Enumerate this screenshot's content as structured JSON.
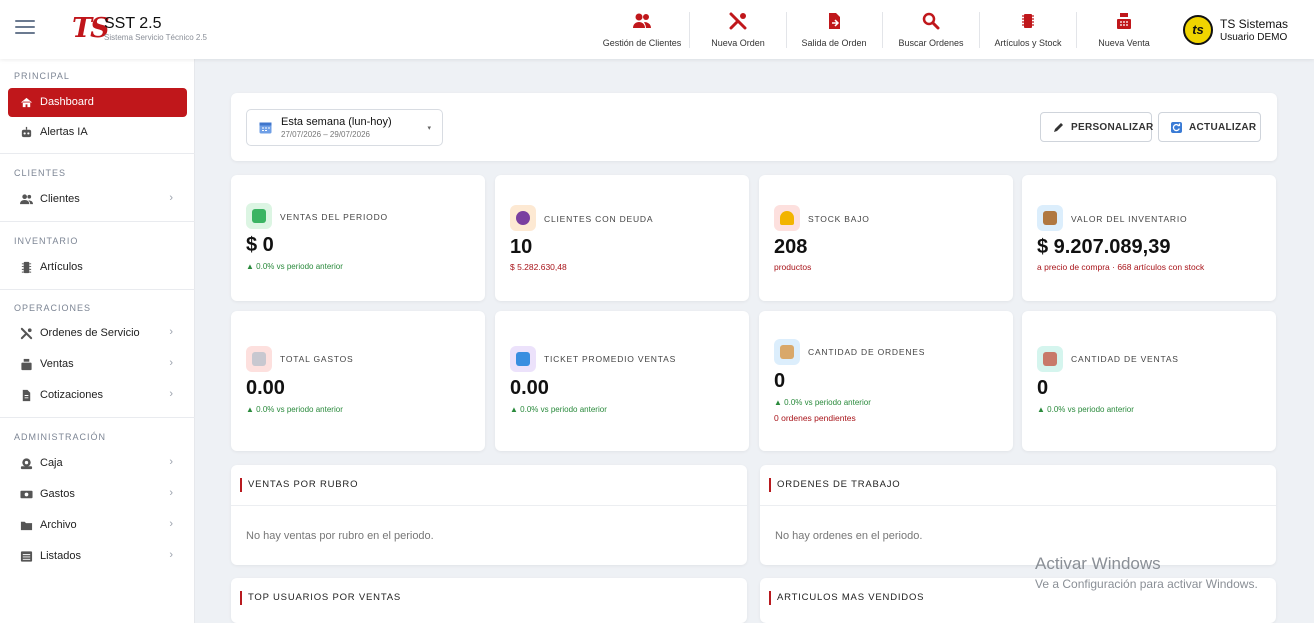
{
  "app": {
    "logo": "TS",
    "title": "SST 2.5",
    "subtitle": "Sistema Servicio Técnico 2.5"
  },
  "topnav": [
    {
      "label": "Gestión de Clientes",
      "icon": "users-icon"
    },
    {
      "label": "Nueva Orden",
      "icon": "tools-icon"
    },
    {
      "label": "Salida de Orden",
      "icon": "file-out-icon"
    },
    {
      "label": "Buscar Ordenes",
      "icon": "search-icon"
    },
    {
      "label": "Artículos y Stock",
      "icon": "chip-icon"
    },
    {
      "label": "Nueva Venta",
      "icon": "cash-register-icon"
    }
  ],
  "user": {
    "avatar_text": "ts",
    "name": "TS Sistemas",
    "role": "Usuario DEMO"
  },
  "sidebar": {
    "sections": [
      {
        "title": "PRINCIPAL"
      },
      {
        "title": "CLIENTES"
      },
      {
        "title": "INVENTARIO"
      },
      {
        "title": "OPERACIONES"
      },
      {
        "title": "ADMINISTRACIÓN"
      }
    ],
    "items": [
      {
        "label": "Dashboard",
        "icon": "home-icon",
        "active": true
      },
      {
        "label": "Alertas IA",
        "icon": "robot-icon"
      },
      {
        "label": "Clientes",
        "icon": "users-icon",
        "chevron": "›"
      },
      {
        "label": "Artículos",
        "icon": "chip-icon"
      },
      {
        "label": "Ordenes de Servicio",
        "icon": "tools-icon",
        "chevron": "›"
      },
      {
        "label": "Ventas",
        "icon": "cash-register-icon",
        "chevron": "›"
      },
      {
        "label": "Cotizaciones",
        "icon": "document-icon",
        "chevron": "›"
      },
      {
        "label": "Caja",
        "icon": "cashbox-icon",
        "chevron": "›"
      },
      {
        "label": "Gastos",
        "icon": "money-icon",
        "chevron": "›"
      },
      {
        "label": "Archivo",
        "icon": "folder-icon",
        "chevron": "›"
      },
      {
        "label": "Listados",
        "icon": "list-icon",
        "chevron": "›"
      }
    ]
  },
  "filter": {
    "range_label": "Esta semana (lun-hoy)",
    "range_dates": "27/07/2026 – 29/07/2026",
    "caret": "▾",
    "customize_label": "PERSONALIZAR",
    "refresh_label": "ACTUALIZAR"
  },
  "kpis": [
    {
      "label": "VENTAS DEL PERIODO",
      "value": "$ 0",
      "delta": "▲ 0.0% vs periodo anterior",
      "icon": "cart-icon",
      "bg": "#dcf5e3",
      "fg": "#3bb463"
    },
    {
      "label": "CLIENTES CON DEUDA",
      "value": "10",
      "note": "$ 5.282.630,48",
      "icon": "person-icon",
      "bg": "#fde9d3",
      "fg": "#7a3fa0"
    },
    {
      "label": "STOCK BAJO",
      "value": "208",
      "note": "productos",
      "icon": "warning-icon",
      "bg": "#fde0de",
      "fg": "#f2b400"
    },
    {
      "label": "VALOR DEL INVENTARIO",
      "value": "$ 9.207.089,39",
      "note": "a precio de compra · 668 artículos con stock",
      "icon": "box-icon",
      "bg": "#dceefc",
      "fg": "#b07840"
    },
    {
      "label": "TOTAL GASTOS",
      "value": "0.00",
      "delta": "▲ 0.0% vs periodo anterior",
      "icon": "receipt-icon",
      "bg": "#fde0de",
      "fg": "#c8c8d0"
    },
    {
      "label": "TICKET PROMEDIO VENTAS",
      "value": "0.00",
      "delta": "▲ 0.0% vs periodo anterior",
      "icon": "bag-icon",
      "bg": "#ece2fb",
      "fg": "#3a8ee0"
    },
    {
      "label": "CANTIDAD DE ORDENES",
      "value": "0",
      "delta": "▲ 0.0% vs periodo anterior",
      "note": "0 ordenes pendientes",
      "icon": "clipboard-icon",
      "bg": "#dceefc",
      "fg": "#d9a86a"
    },
    {
      "label": "CANTIDAD DE VENTAS",
      "value": "0",
      "delta": "▲ 0.0% vs periodo anterior",
      "icon": "register-icon",
      "bg": "#d5f5ee",
      "fg": "#c87a6a"
    }
  ],
  "panels": [
    {
      "title": "VENTAS POR RUBRO",
      "empty": "No hay ventas por rubro en el periodo."
    },
    {
      "title": "ORDENES DE TRABAJO",
      "empty": "No hay ordenes en el periodo."
    },
    {
      "title": "TOP USUARIOS POR VENTAS"
    },
    {
      "title": "ARTICULOS MAS VENDIDOS"
    }
  ],
  "watermark": {
    "line1": "Activar Windows",
    "line2": "Ve a Configuración para activar Windows."
  },
  "colors": {
    "brand_red": "#c0171b",
    "positive_green": "#2a8a3c"
  }
}
